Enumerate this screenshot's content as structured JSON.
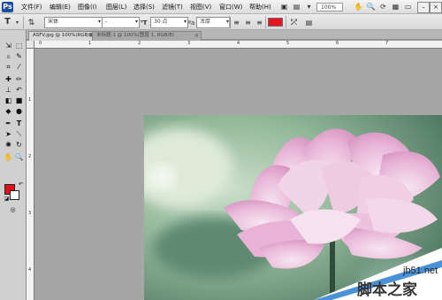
{
  "menubar": {
    "logo": "Ps",
    "items": [
      "文件(F)",
      "编辑(E)",
      "图像(I)",
      "图层(L)",
      "选择(S)",
      "滤镜(T)",
      "视图(V)",
      "窗口(W)",
      "帮助(H)"
    ],
    "zoom": "100%"
  },
  "options": {
    "font_family": "宋体",
    "font_style": "-",
    "font_size": "30 点",
    "antialias": "浑厚",
    "text_color": "#e8131e"
  },
  "tabs": [
    {
      "label": "ASFV.jpg @ 100%(RGB/8)",
      "active": true
    },
    {
      "label": "未标题-1 @ 100%(图层 1, RGB/8)",
      "active": false
    }
  ],
  "toolbox": {
    "foreground_color": "#e3101c",
    "background_color": "#ffffff"
  },
  "rulers": {
    "top_labels": [
      "0",
      "1",
      "2",
      "3",
      "4",
      "5",
      "6",
      "7"
    ],
    "left_labels": [
      "1",
      "2",
      "3",
      "4"
    ]
  },
  "watermark": {
    "url": "jb51.net",
    "site": "脚本之家"
  }
}
